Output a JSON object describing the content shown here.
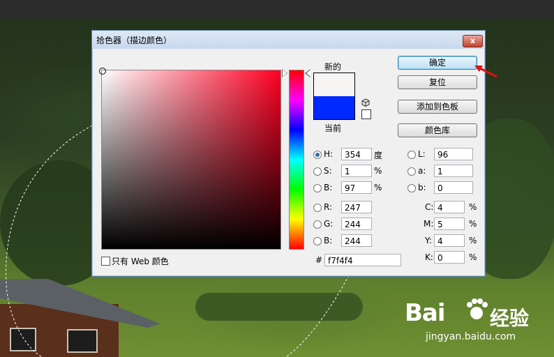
{
  "dialog": {
    "title": "拾色器（描边颜色）",
    "close_glyph": "x",
    "labels": {
      "new": "新的",
      "current": "当前"
    },
    "colors": {
      "new": "#f7f4f4",
      "current": "#0029ff"
    },
    "buttons": {
      "ok": "确定",
      "reset": "复位",
      "add_to_swatches": "添加到色板",
      "color_libraries": "颜色库"
    },
    "hsb": {
      "h": {
        "label": "H:",
        "value": "354",
        "unit": "度"
      },
      "s": {
        "label": "S:",
        "value": "1",
        "unit": "%"
      },
      "b": {
        "label": "B:",
        "value": "97",
        "unit": "%"
      }
    },
    "rgb": {
      "r": {
        "label": "R:",
        "value": "247"
      },
      "g": {
        "label": "G:",
        "value": "244"
      },
      "b": {
        "label": "B:",
        "value": "244"
      }
    },
    "lab": {
      "l": {
        "label": "L:",
        "value": "96"
      },
      "a": {
        "label": "a:",
        "value": "1"
      },
      "b": {
        "label": "b:",
        "value": "0"
      }
    },
    "cmyk": {
      "c": {
        "label": "C:",
        "value": "4",
        "unit": "%"
      },
      "m": {
        "label": "M:",
        "value": "5",
        "unit": "%"
      },
      "y": {
        "label": "Y:",
        "value": "4",
        "unit": "%"
      },
      "k": {
        "label": "K:",
        "value": "0",
        "unit": "%"
      }
    },
    "hex": {
      "label": "#",
      "value": "f7f4f4"
    },
    "web_only": {
      "label": "只有 Web 颜色",
      "checked": false
    },
    "selected_mode": "H"
  },
  "watermark": {
    "brand": "Bai",
    "brand_cn": "经验",
    "url": "jingyan.baidu.com"
  }
}
